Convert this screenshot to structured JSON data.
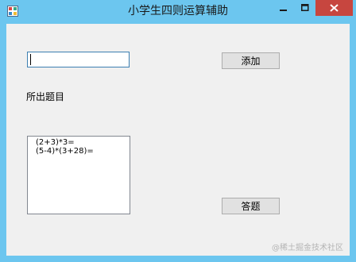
{
  "window": {
    "title": "小学生四则运算辅助"
  },
  "form": {
    "input_value": "",
    "add_label": "添加",
    "questions_label": "所出题目",
    "answer_label": "答题",
    "questions": [
      "(2+3)*3=",
      "(5-4)*(3+28)="
    ]
  },
  "watermark": "@稀土掘金技术社区",
  "colors": {
    "titlebar": "#6cc6ef",
    "close": "#c7463f",
    "client": "#f0f0f0"
  }
}
